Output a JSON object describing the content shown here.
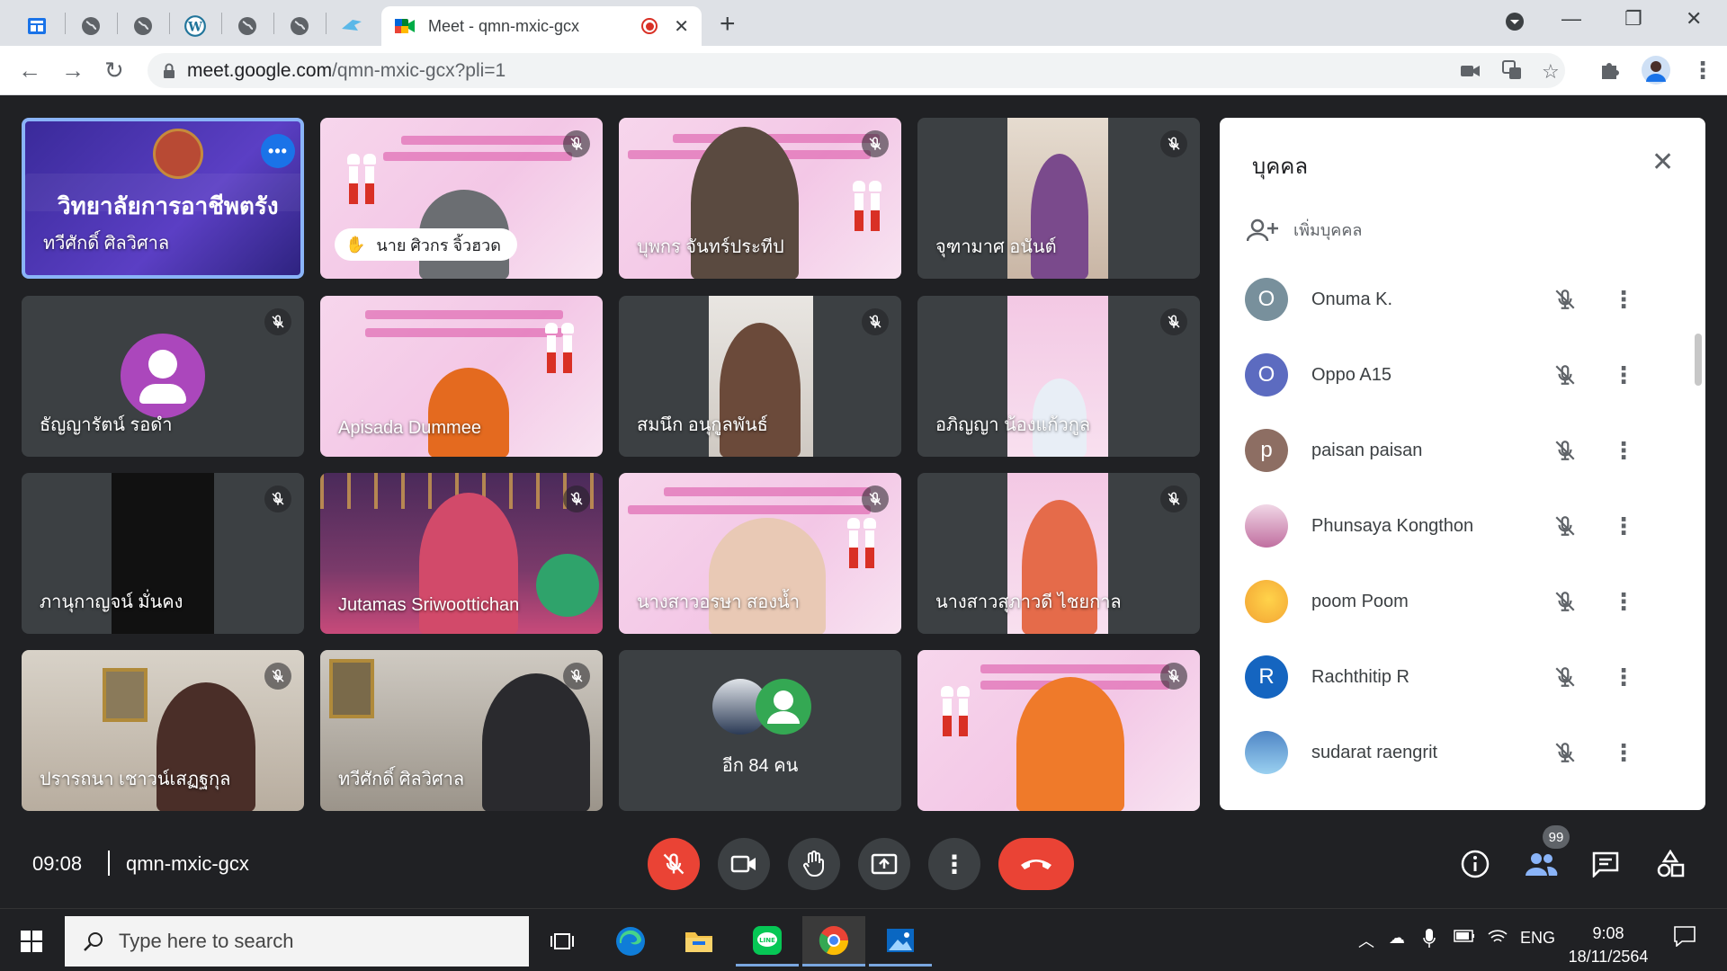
{
  "browser": {
    "active_tab_title": "Meet - qmn-mxic-gcx",
    "url_host": "meet.google.com",
    "url_path": "/qmn-mxic-gcx?pli=1"
  },
  "tiles": [
    {
      "name": "ทวีศักดิ์ ศิลวิศาล",
      "banner": "วิทยาลัยการอาชีพตรัง"
    },
    {
      "name": "นาย ศิวกร จิ้วฮวด"
    },
    {
      "name": "บุพกร จันทร์ประทีป"
    },
    {
      "name": "จุฑามาศ อนันต์"
    },
    {
      "name": "ธัญญารัตน์ รอดำ"
    },
    {
      "name": "Apisada Dummee"
    },
    {
      "name": "สมนึก อนุกูลพันธ์"
    },
    {
      "name": "อภิญญา น้องแก้วกูล"
    },
    {
      "name": "ภานุกาญจน์ มั่นคง"
    },
    {
      "name": "Jutamas Sriwoottichan"
    },
    {
      "name": "นางสาวอรษา สองน้ำ"
    },
    {
      "name": "นางสาวสุภาวดี ไชยกาล"
    },
    {
      "name": "ปรารถนา เชาวน์เสฏฐกุล"
    },
    {
      "name": "ทวีศักดิ์ ศิลวิศาล"
    },
    {
      "name": "อีก 84 คน"
    },
    {
      "name": ""
    }
  ],
  "panel": {
    "title": "บุคคล",
    "add_label": "เพิ่มบุคคล",
    "people": [
      {
        "name": "Onuma K.",
        "initial": "O",
        "color": "#78909c"
      },
      {
        "name": "Oppo A15",
        "initial": "O",
        "color": "#5c6bc0"
      },
      {
        "name": "paisan paisan",
        "initial": "p",
        "color": "#8d6e63"
      },
      {
        "name": "Phunsaya Kongthon",
        "initial": "",
        "color": "#c06fa0"
      },
      {
        "name": "poom Poom",
        "initial": "",
        "color": "#f2b233"
      },
      {
        "name": "Rachthitip R",
        "initial": "R",
        "color": "#1565c0"
      },
      {
        "name": "sudarat raengrit",
        "initial": "",
        "color": "#4f86c6"
      }
    ]
  },
  "meeting": {
    "time": "09:08",
    "code": "qmn-mxic-gcx",
    "people_badge": "99"
  },
  "taskbar": {
    "search_placeholder": "Type here to search",
    "lang": "ENG",
    "time": "9:08",
    "date": "18/11/2564"
  },
  "colors": {
    "meet_bg": "#202124",
    "tile_bg": "#3c4043",
    "active_border": "#8ab4f8",
    "danger": "#ea4335"
  }
}
